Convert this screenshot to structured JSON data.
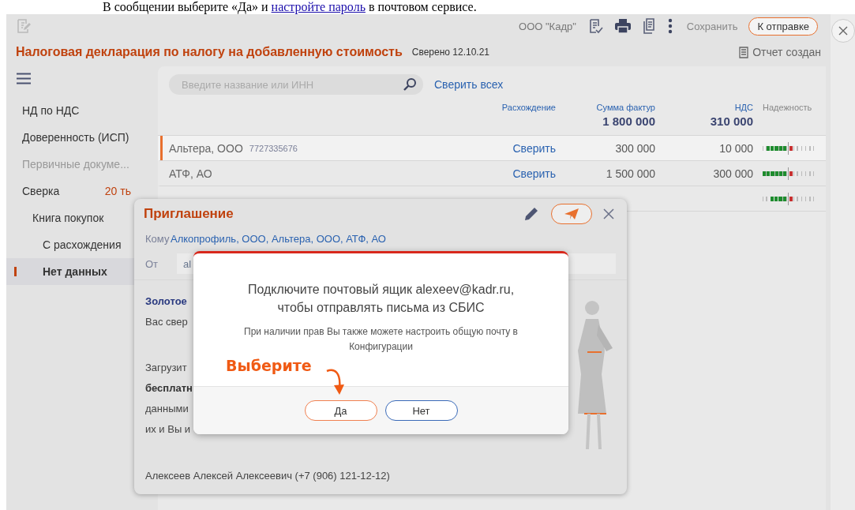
{
  "document_line": {
    "before": "В сообщении выберите «Да» и ",
    "link": "настройте пароль",
    "after": " в почтовом сервисе."
  },
  "toolbar": {
    "organization": "ООО \"Кадр\"",
    "save": "Сохранить",
    "send": "К отправке"
  },
  "header": {
    "title": "Налоговая декларация по налогу на добавленную стоимость",
    "verified": "Сверено 12.10.21",
    "report_status": "Отчет создан"
  },
  "sidebar": {
    "items": [
      {
        "label": "НД по НДС",
        "disabled": false,
        "selected": false
      },
      {
        "label": "Доверенность (ИСП)",
        "disabled": false,
        "selected": false
      },
      {
        "label": "Первичные докуме...",
        "disabled": true,
        "selected": false
      },
      {
        "label": "Сверка",
        "count": "20 ть",
        "disabled": false,
        "selected": false,
        "children": [
          {
            "label": "Книга покупок",
            "disabled": false,
            "selected": false,
            "children": [
              {
                "label": "С расхождения",
                "disabled": false,
                "selected": false
              },
              {
                "label": "Нет данных",
                "disabled": false,
                "selected": true
              }
            ]
          }
        ]
      }
    ]
  },
  "search": {
    "placeholder": "Введите название или ИНН"
  },
  "reconcile_all": "Сверить всех",
  "table": {
    "columns": [
      {
        "label": "Расхождение"
      },
      {
        "label": "Сумма фактур",
        "total": "1 800 000"
      },
      {
        "label": "НДС",
        "total": "310 000"
      },
      {
        "label": "Надежность"
      }
    ],
    "rows": [
      {
        "name": "Альтера, ООО",
        "inn": "7727335676",
        "action": "Сверить",
        "amount": "300 000",
        "vat": "10 000",
        "level": 0.83,
        "selected": true
      },
      {
        "name": "АТФ, АО",
        "action": "Сверить",
        "amount": "1 500 000",
        "vat": "300 000",
        "level": 1,
        "selected": false
      },
      {
        "level": 0.67,
        "selected": false
      }
    ]
  },
  "invitation": {
    "title": "Приглашение",
    "to_label": "Кому",
    "recipients": "Алкопрофиль, ООО, Альтера, ООО, АТФ, АО",
    "from_label": "От",
    "from_value": "al",
    "paragraphs": [
      [
        {
          "text": "Золотое",
          "kind": "heading"
        },
        {
          "text": "Вас свер",
          "kind": "plain"
        }
      ],
      [
        {
          "text": "Загрузит",
          "kind": "plain"
        },
        {
          "text": "бесплатн",
          "kind": "bold"
        },
        {
          "text": "данными",
          "kind": "plain"
        },
        {
          "text": "их и Вы и",
          "kind": "plain"
        }
      ]
    ],
    "signature": "Алексеев Алексей Алексеевич (+7 (906) 121-12-12)"
  },
  "confirm": {
    "message": "Подключите почтовый ящик alexeev@kadr.ru, чтобы отправлять письма из СБИС",
    "note": "При наличии прав Вы также можете настроить общую почту в Конфигурации",
    "buttons": [
      {
        "label": "Да",
        "selected": true
      },
      {
        "label": "Нет",
        "selected": false
      }
    ]
  },
  "annotation": {
    "text": "Выберите"
  }
}
